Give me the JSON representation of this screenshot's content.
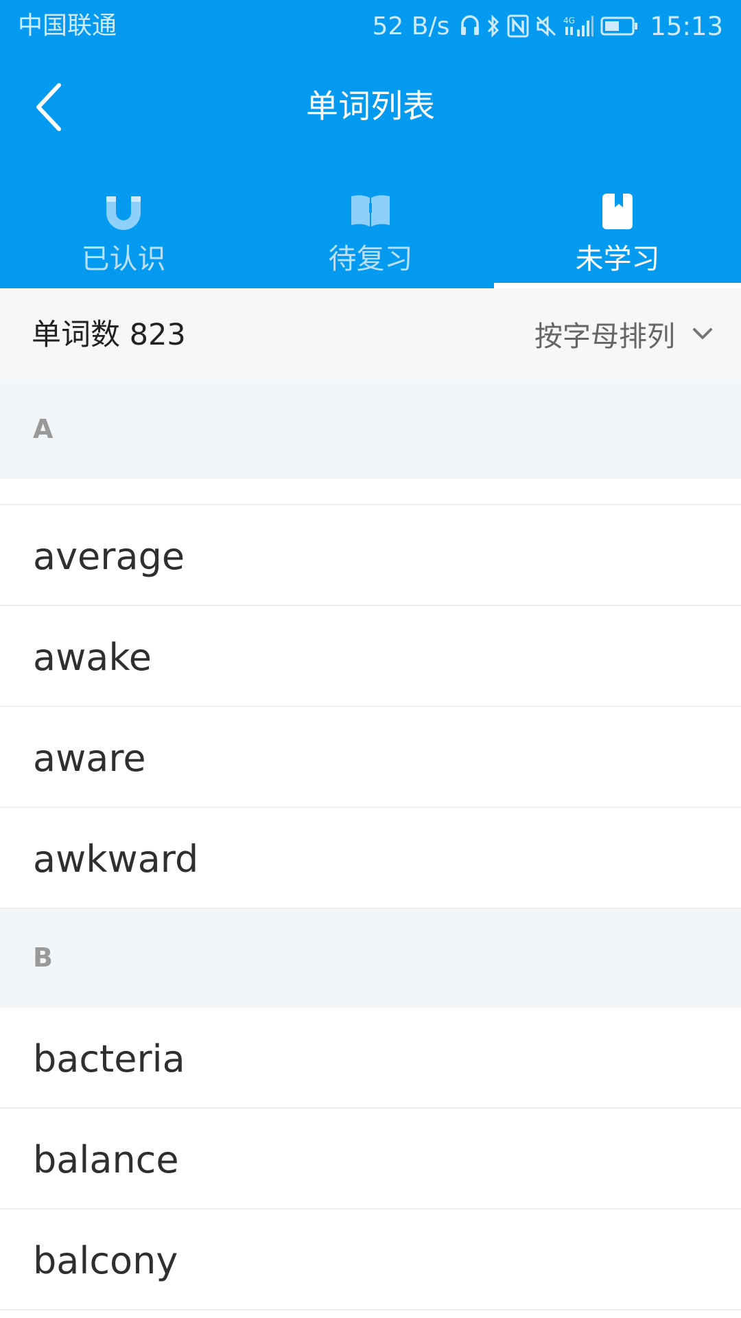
{
  "status_bar": {
    "carrier": "中国联通",
    "net_speed": "52 B/s",
    "time": "15:13",
    "icons": [
      "headset-icon",
      "bluetooth-icon",
      "nfc-icon",
      "mute-icon",
      "signal-4g-icon",
      "battery-icon"
    ]
  },
  "header": {
    "title": "单词列表",
    "back_icon": "chevron-left-icon",
    "accent_color": "#039AF0"
  },
  "tabs": [
    {
      "label": "已认识",
      "icon": "magnet-icon",
      "active": false
    },
    {
      "label": "待复习",
      "icon": "open-book-icon",
      "active": false
    },
    {
      "label": "未学习",
      "icon": "bookmark-book-icon",
      "active": true
    }
  ],
  "toolbar": {
    "word_count": "单词数 823",
    "sort_label": "按字母排列",
    "sort_icon": "chevron-down-icon"
  },
  "sections": [
    {
      "letter": "A",
      "words": [
        "average",
        "awake",
        "aware",
        "awkward"
      ]
    },
    {
      "letter": "B",
      "words": [
        "bacteria",
        "balance",
        "balcony"
      ]
    }
  ]
}
